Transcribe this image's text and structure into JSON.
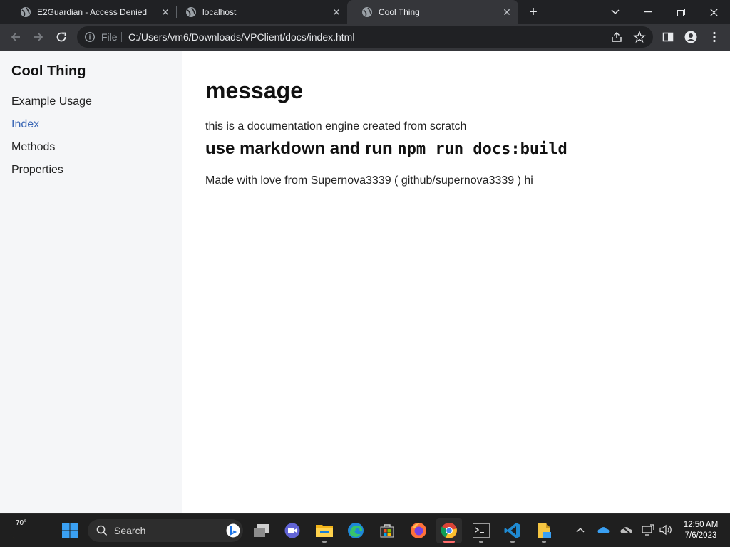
{
  "browser": {
    "tabs": [
      {
        "title": "E2Guardian - Access Denied",
        "active": false
      },
      {
        "title": "localhost",
        "active": false
      },
      {
        "title": "Cool Thing",
        "active": true
      }
    ],
    "scheme_label": "File",
    "url": "C:/Users/vm6/Downloads/VPClient/docs/index.html"
  },
  "sidebar": {
    "title": "Cool Thing",
    "items": [
      {
        "label": "Example Usage",
        "active": false
      },
      {
        "label": "Index",
        "active": true
      },
      {
        "label": "Methods",
        "active": false
      },
      {
        "label": "Properties",
        "active": false
      }
    ]
  },
  "content": {
    "heading": "message",
    "intro": "this is a documentation engine created from scratch",
    "subheading_text": "use markdown and run ",
    "subheading_code": "npm run docs:build",
    "credit": "Made with love from Supernova3339 ( github/supernova3339 ) hi"
  },
  "taskbar": {
    "weather_temp": "70°",
    "search_label": "Search",
    "apps": [
      "task-view",
      "meet",
      "file-explorer",
      "edge",
      "store",
      "firefox",
      "chrome",
      "terminal",
      "vscode",
      "notepad"
    ],
    "time": "12:50 AM",
    "date": "7/6/2023"
  },
  "colors": {
    "chrome_dark": "#202124",
    "chrome_toolbar": "#35363a",
    "sidebar_bg": "#f5f6f8",
    "link_active": "#3b67b5",
    "taskbar_bg": "#1f1f1f"
  }
}
